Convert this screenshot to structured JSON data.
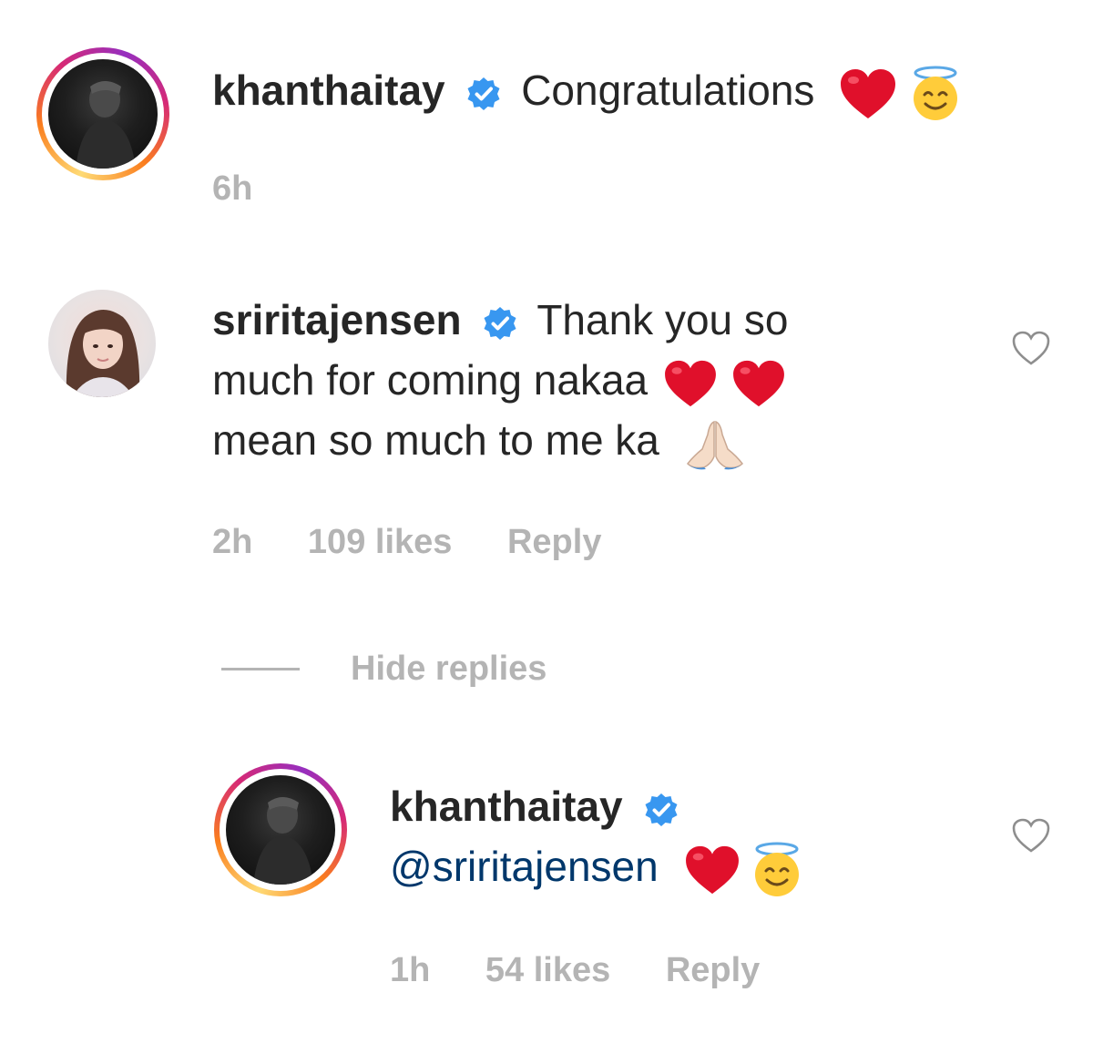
{
  "comments": [
    {
      "username": "khanthaitay",
      "text": "Congratulations",
      "time": "6h"
    },
    {
      "username": "sriritajensen",
      "text_line1": "Thank you so",
      "text_line2": "much for coming nakaa",
      "text_line3": "mean so much to me ka",
      "time": "2h",
      "likes": "109 likes",
      "reply_label": "Reply"
    }
  ],
  "hide_replies_label": "Hide replies",
  "reply": {
    "username": "khanthaitay",
    "mention": "@sriritajensen",
    "time": "1h",
    "likes": "54 likes",
    "reply_label": "Reply"
  },
  "colors": {
    "verified_blue": "#3897f0",
    "meta_gray": "#b4b4b4",
    "mention_blue": "#00376b",
    "heart_red": "#e0102b"
  }
}
